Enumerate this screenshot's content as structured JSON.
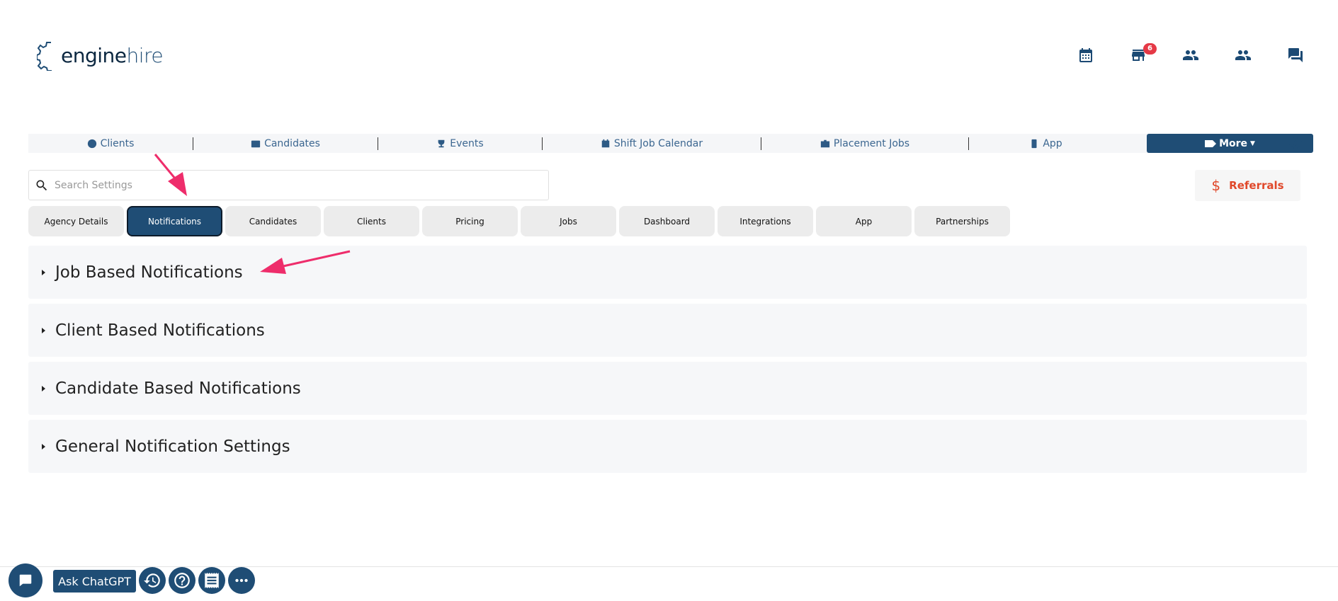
{
  "brand": {
    "logo_part1": "engine",
    "logo_part2": "hire"
  },
  "header_icons": [
    {
      "name": "calendar-icon"
    },
    {
      "name": "store-icon",
      "badge": "6"
    },
    {
      "name": "people-icon"
    },
    {
      "name": "people-icon"
    },
    {
      "name": "chat-icon"
    }
  ],
  "main_nav": {
    "items": [
      "Clients",
      "Candidates",
      "Events",
      "Shift Job Calendar",
      "Placement Jobs",
      "App"
    ],
    "more_label": "More"
  },
  "search": {
    "placeholder": "Search Settings",
    "value": ""
  },
  "referrals_label": "Referrals",
  "settings_tabs": [
    "Agency Details",
    "Notifications",
    "Candidates",
    "Clients",
    "Pricing",
    "Jobs",
    "Dashboard",
    "Integrations",
    "App",
    "Partnerships"
  ],
  "active_tab": "Notifications",
  "sections": [
    "Job Based Notifications",
    "Client Based Notifications",
    "Candidate Based Notifications",
    "General Notification Settings"
  ],
  "bottom": {
    "ask_label": "Ask ChatGPT"
  },
  "colors": {
    "primary": "#1f4d75",
    "badge": "#e53946",
    "referrals": "#e0482a",
    "annotation": "#ee2d6b"
  }
}
